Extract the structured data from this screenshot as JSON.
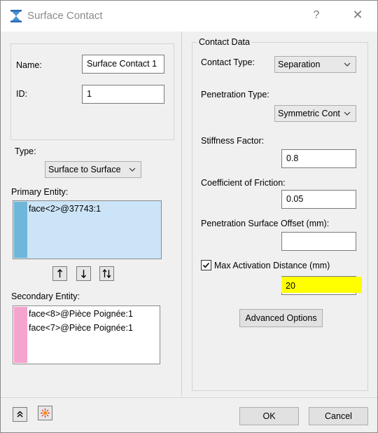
{
  "window": {
    "title": "Surface Contact",
    "help_glyph": "?",
    "close_glyph": "✕"
  },
  "left": {
    "name_label": "Name:",
    "name_value": "Surface Contact 1",
    "id_label": "ID:",
    "id_value": "1",
    "type_label": "Type:",
    "type_value": "Surface to Surface",
    "primary_label": "Primary Entity:",
    "primary_items": [
      "face<2>@37743:1"
    ],
    "secondary_label": "Secondary Entity:",
    "secondary_items": [
      "face<8>@Pièce Poignée:1",
      "face<7>@Pièce Poignée:1"
    ]
  },
  "contact": {
    "group_title": "Contact Data",
    "contact_type_label": "Contact Type:",
    "contact_type_value": "Separation",
    "penetration_type_label": "Penetration Type:",
    "penetration_type_value": "Symmetric Cont",
    "stiffness_label": "Stiffness Factor:",
    "stiffness_value": "0.8",
    "friction_label": "Coefficient of Friction:",
    "friction_value": "0.05",
    "offset_label": "Penetration Surface Offset (mm):",
    "offset_value": "",
    "max_activation_label": "Max Activation Distance (mm)",
    "max_activation_checked": true,
    "max_activation_value": "20",
    "advanced_button": "Advanced Options"
  },
  "footer": {
    "ok_label": "OK",
    "cancel_label": "Cancel"
  },
  "colors": {
    "primary_swatch": "#6fb7da",
    "primary_list_bg": "#cce4f7",
    "secondary_swatch": "#f5a3cf",
    "highlight": "#ffff00"
  }
}
